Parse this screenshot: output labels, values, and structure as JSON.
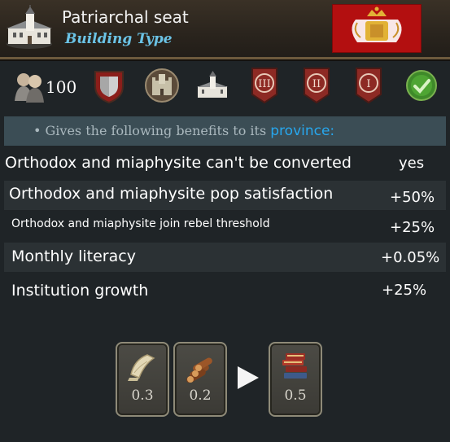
{
  "header": {
    "title": "Patriarchal seat",
    "subtitle": "Building Type",
    "building_icon": "monastery-building-icon",
    "flag_icon": "patriarchate-coat-of-arms-icon",
    "flag_color": "#b30f10"
  },
  "icons": {
    "cost_icon": "clergy-pop-icon",
    "cost_value": "100",
    "items": [
      "shield-icon",
      "stone-fortress-icon",
      "monastery-building-icon",
      "roman-numeral-three-banner-icon",
      "roman-numeral-two-banner-icon",
      "roman-numeral-one-banner-icon",
      "green-checkmark-icon"
    ]
  },
  "benefits": {
    "intro": "• Gives the following benefits to its",
    "intro_link": "province:",
    "link_color": "#27a7ee",
    "rows": [
      {
        "label": "Orthodox and miaphysite can't be converted",
        "value": "yes"
      },
      {
        "label": "Orthodox and miaphysite pop satisfaction",
        "value": "+50%"
      },
      {
        "label": "Orthodox and miaphysite join rebel threshold",
        "value": "+25%"
      },
      {
        "label": "Monthly literacy",
        "value": "+0.05%"
      },
      {
        "label": "Institution growth",
        "value": "+25%"
      }
    ]
  },
  "production": {
    "inputs": [
      {
        "icon": "paper-goods-icon",
        "value": "0.3"
      },
      {
        "icon": "wood-logs-goods-icon",
        "value": "0.2"
      }
    ],
    "arrow_icon": "arrow-right-icon",
    "output": {
      "icon": "books-goods-icon",
      "value": "0.5"
    }
  }
}
